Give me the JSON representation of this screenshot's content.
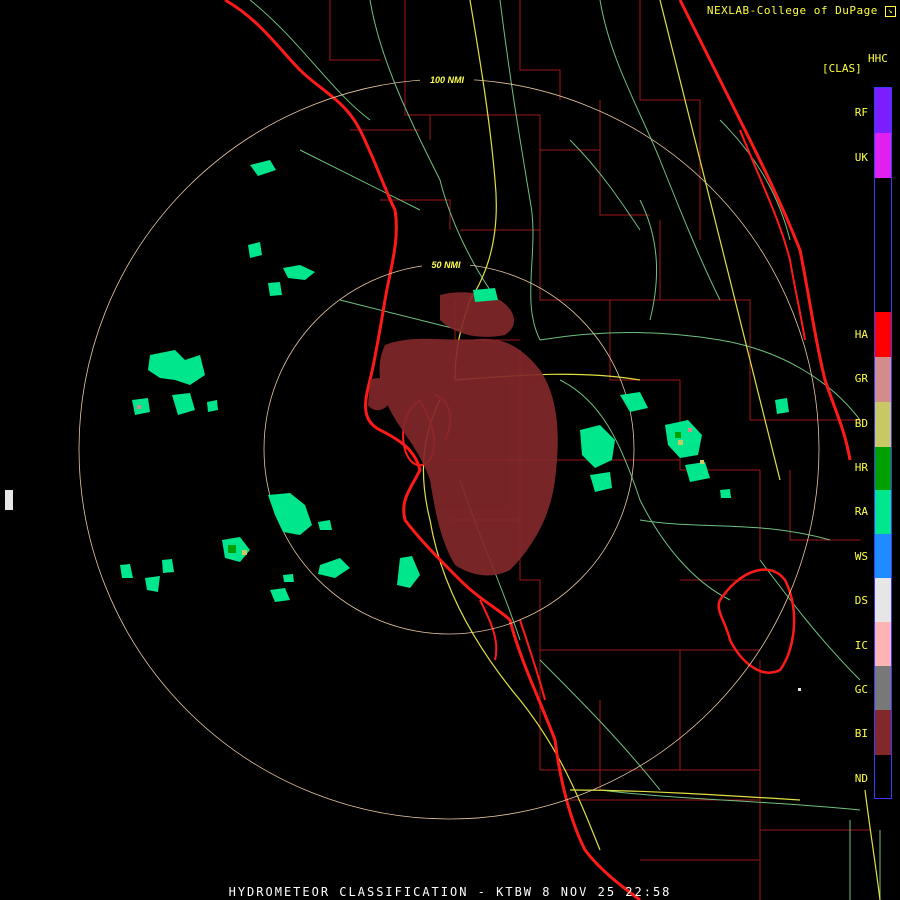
{
  "credit": "NEXLAB-College of DuPage",
  "credit_icon": "expand-arrow-icon",
  "legend": {
    "product": "HHC",
    "units": "[CLAS]",
    "classes": [
      {
        "code": "RF",
        "color": "#7a1fff"
      },
      {
        "code": "UK",
        "color": "#e020f0"
      },
      {
        "code": "HA",
        "color": "#ff0000"
      },
      {
        "code": "GR",
        "color": "#d28c8c"
      },
      {
        "code": "BD",
        "color": "#c8c864"
      },
      {
        "code": "HR",
        "color": "#00a000"
      },
      {
        "code": "RA",
        "color": "#00e68c"
      },
      {
        "code": "WS",
        "color": "#1e8cff"
      },
      {
        "code": "DS",
        "color": "#e6e6e6"
      },
      {
        "code": "IC",
        "color": "#ffb4b4"
      },
      {
        "code": "GC",
        "color": "#787878"
      },
      {
        "code": "BI",
        "color": "#82282a"
      },
      {
        "code": "ND",
        "color": "#000000"
      }
    ]
  },
  "rings": [
    {
      "label": "50 NMI"
    },
    {
      "label": "100 NMI"
    }
  ],
  "footer": "HYDROMETEOR CLASSIFICATION - KTBW 8 NOV 25 22:58",
  "colors": {
    "coast": "#ff1010",
    "county": "#b01818",
    "highway": "#e8e850",
    "road": "#80d090",
    "ring": "#e8c8a0"
  }
}
